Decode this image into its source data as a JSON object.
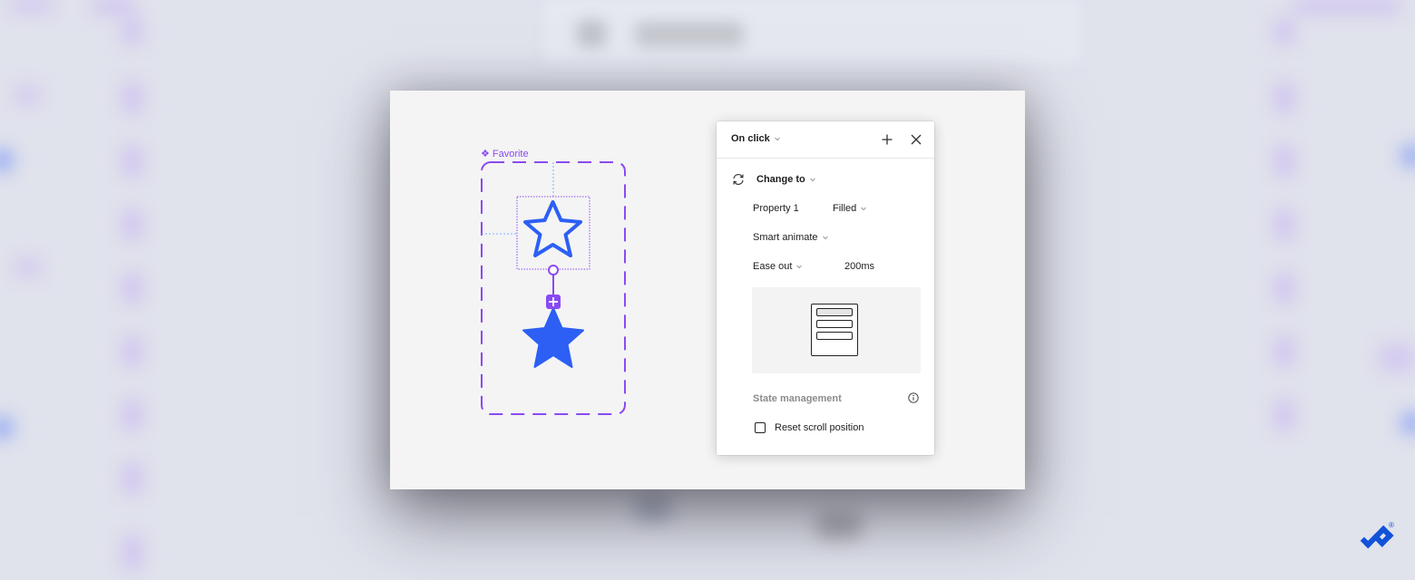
{
  "component": {
    "label": "Favorite",
    "label_glyph": "❖",
    "variants": [
      "outline-star",
      "filled-star"
    ]
  },
  "panel": {
    "trigger": "On click",
    "action": "Change to",
    "property_name": "Property 1",
    "property_value": "Filled",
    "animation": "Smart animate",
    "easing": "Ease out",
    "duration": "200ms",
    "state_section_title": "State management",
    "reset_scroll_label": "Reset scroll position",
    "reset_scroll_checked": false
  },
  "colors": {
    "component_purple": "#8a4af3",
    "star_blue": "#2d5ff5",
    "guide_blue": "#7fb0ff",
    "brand_blue": "#1152d9"
  },
  "brand": {
    "mark": "®"
  }
}
